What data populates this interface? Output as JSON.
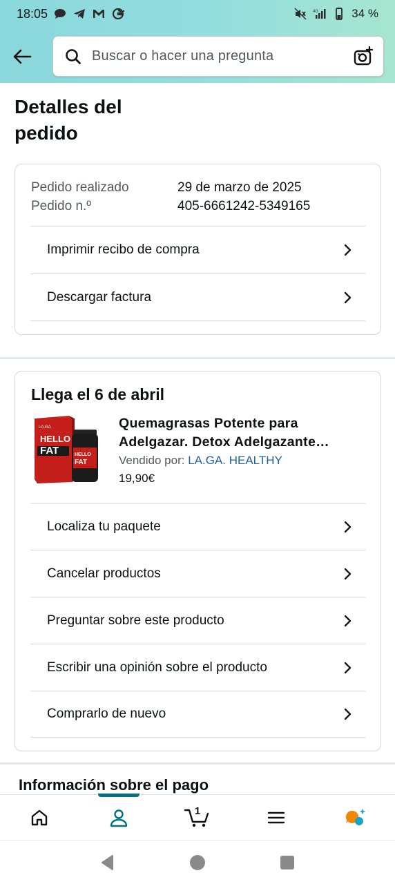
{
  "status_bar": {
    "time": "18:05",
    "battery": "34 %",
    "left_icons": [
      "chat-bubble-icon",
      "telegram-icon",
      "gmail-icon",
      "google-icon"
    ],
    "right_icons": [
      "mute-icon",
      "signal-icon",
      "battery-icon"
    ]
  },
  "header": {
    "search_placeholder": "Buscar o hacer una pregunta"
  },
  "page_title": "Detalles del pedido",
  "order": {
    "placed_label": "Pedido realizado",
    "placed_value": "29 de marzo de 2025",
    "number_label": "Pedido n.º",
    "number_value": "405-6661242-5349165",
    "actions": [
      {
        "label": "Imprimir recibo de compra"
      },
      {
        "label": "Descargar factura"
      }
    ]
  },
  "delivery": {
    "title": "Llega el 6 de abril",
    "product": {
      "title": "Quemagrasas Potente para Adelgazar. Detox Adelgazante Potente",
      "sold_by_label": "Vendido por:",
      "seller": "LA.GA. HEALTHY",
      "price": "19,90€",
      "image_text_top": "HELLO",
      "image_text_bottom": "FAT",
      "image_brand": "LA.GA"
    },
    "actions": [
      {
        "label": "Localiza tu paquete"
      },
      {
        "label": "Cancelar productos"
      },
      {
        "label": "Preguntar sobre este producto"
      },
      {
        "label": "Escribir una opinión sobre el producto"
      },
      {
        "label": "Comprarlo de nuevo"
      }
    ]
  },
  "payment_section": {
    "title": "Información sobre el pago"
  },
  "bottom_nav": {
    "cart_count": "1",
    "active_tab": "account",
    "accent_color": "#007185"
  }
}
